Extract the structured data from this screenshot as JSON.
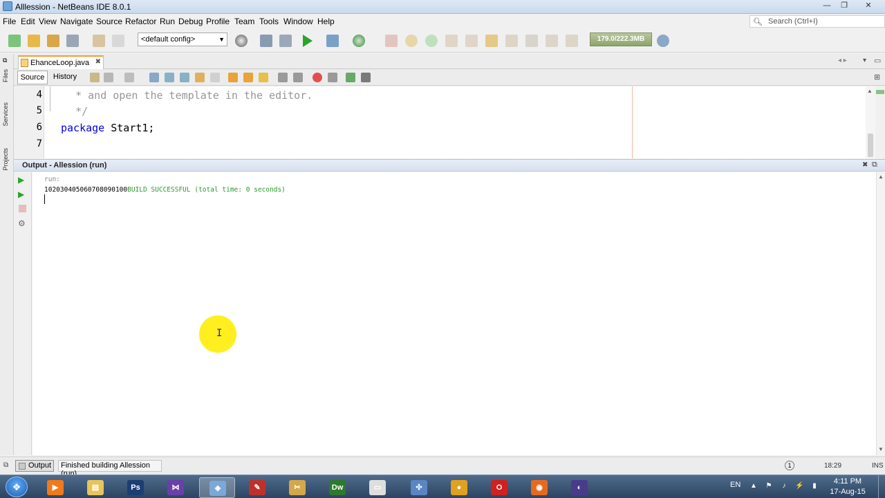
{
  "window": {
    "title": "Alllession - NetBeans IDE 8.0.1",
    "minimize_glyph": "—",
    "maximize_glyph": "❐",
    "close_glyph": "✕"
  },
  "menu": [
    "File",
    "Edit",
    "View",
    "Navigate",
    "Source",
    "Refactor",
    "Run",
    "Debug",
    "Profile",
    "Team",
    "Tools",
    "Window",
    "Help"
  ],
  "search": {
    "placeholder": "Search (Ctrl+I)"
  },
  "toolbar": {
    "config_value": "<default config>",
    "memory": "179.0/222.3MB"
  },
  "side_tabs": [
    "Files",
    "Services",
    "Projects"
  ],
  "editor": {
    "tab_label": "EhanceLoop.java",
    "source_label": "Source",
    "history_label": "History",
    "lines": [
      {
        "num": "4",
        "text": "   * and open the template in the editor.",
        "kind": "comment"
      },
      {
        "num": "5",
        "text": "   */",
        "kind": "comment"
      },
      {
        "num": "6",
        "text": "package Start1;",
        "kind": "code"
      },
      {
        "num": "7",
        "text": "",
        "kind": "code"
      }
    ]
  },
  "output": {
    "title": "Output - Allession (run)",
    "run_label": "run:",
    "printed": "102030405060708090100",
    "build_msg": "BUILD SUCCESSFUL (total time: 0 seconds)"
  },
  "statusbar": {
    "output_tab": "Output",
    "message": "Finished building Allession (run).",
    "caret": "18:29",
    "mode": "INS"
  },
  "taskbar": {
    "lang": "EN",
    "time": "4:11 PM",
    "date": "17-Aug-15",
    "apps": [
      {
        "name": "media-player",
        "color": "#f07a1a",
        "glyph": "▶"
      },
      {
        "name": "file-explorer",
        "color": "#e8c45a",
        "glyph": "▤"
      },
      {
        "name": "photoshop",
        "color": "#1b3f73",
        "glyph": "Ps"
      },
      {
        "name": "visual-studio",
        "color": "#6b3fa8",
        "glyph": "⋈"
      },
      {
        "name": "netbeans",
        "color": "#7aa8d8",
        "glyph": "◈"
      },
      {
        "name": "app-red",
        "color": "#c0302a",
        "glyph": "✎"
      },
      {
        "name": "tools",
        "color": "#d4a84a",
        "glyph": "✂"
      },
      {
        "name": "dreamweaver",
        "color": "#2d7a2d",
        "glyph": "Dw"
      },
      {
        "name": "window",
        "color": "#dedede",
        "glyph": "▭"
      },
      {
        "name": "network",
        "color": "#5a86c4",
        "glyph": "✣"
      },
      {
        "name": "chrome",
        "color": "#e0a020",
        "glyph": "●"
      },
      {
        "name": "opera",
        "color": "#d21f1f",
        "glyph": "O"
      },
      {
        "name": "firefox",
        "color": "#e66a1e",
        "glyph": "◉"
      },
      {
        "name": "eclipse",
        "color": "#4a3b8a",
        "glyph": "◐"
      }
    ]
  }
}
